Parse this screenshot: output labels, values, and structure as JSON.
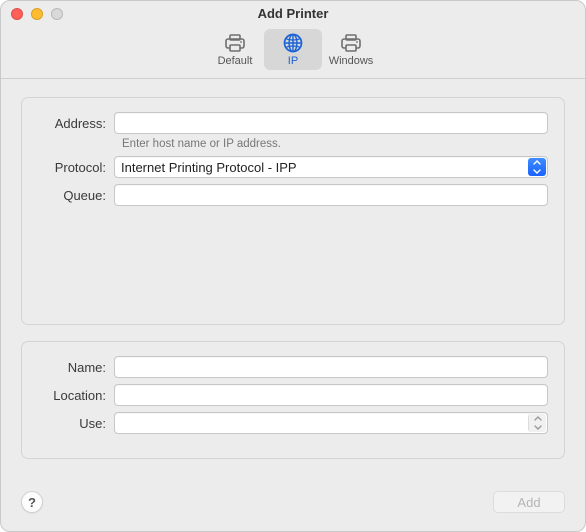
{
  "window": {
    "title": "Add Printer"
  },
  "toolbar": {
    "items": [
      {
        "label": "Default"
      },
      {
        "label": "IP"
      },
      {
        "label": "Windows"
      }
    ],
    "selected_index": 1
  },
  "form_top": {
    "address_label": "Address:",
    "address_value": "",
    "address_hint": "Enter host name or IP address.",
    "protocol_label": "Protocol:",
    "protocol_value": "Internet Printing Protocol - IPP",
    "queue_label": "Queue:",
    "queue_value": ""
  },
  "form_bottom": {
    "name_label": "Name:",
    "name_value": "",
    "location_label": "Location:",
    "location_value": "",
    "use_label": "Use:",
    "use_value": ""
  },
  "footer": {
    "help_symbol": "?",
    "add_label": "Add",
    "add_enabled": false
  }
}
